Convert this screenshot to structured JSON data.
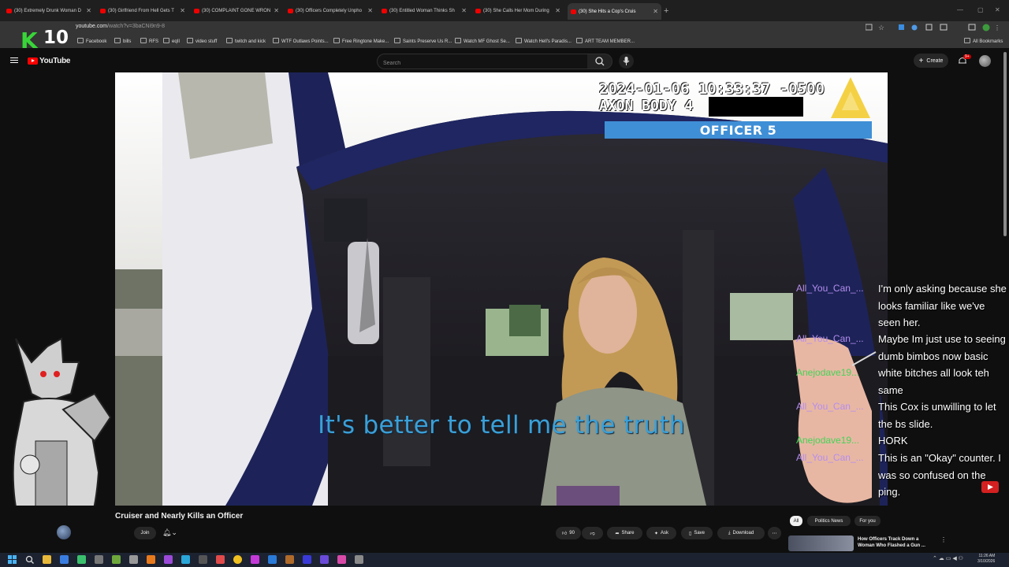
{
  "browser": {
    "tabs": [
      {
        "title": "(30) Extremely Drunk Woman D"
      },
      {
        "title": "(30) Girlfriend From Hell Gets T"
      },
      {
        "title": "(30) COMPLAINT GONE WRON"
      },
      {
        "title": "(30) Officers Completely Unpho"
      },
      {
        "title": "(30) Entitled Woman Thinks Sh"
      },
      {
        "title": "(30) She Calls Her Mom During"
      },
      {
        "title": "(30) She Hits a Cop's Cruis"
      }
    ],
    "url": "youtube.com",
    "url_path": "/watch?v=3baCNi9n9-8",
    "bookmarks": [
      "Facebook",
      "bills",
      "RFS",
      "eqII",
      "video stuff",
      "twitch and kick",
      "WTF Outlaws Points...",
      "Free Ringtone Make...",
      "Saints Preserve Us R...",
      "Watch MF Ghost Se...",
      "Watch Hell's Paradis...",
      "ART TEAM MEMBER..."
    ],
    "all_bookmarks": "All Bookmarks"
  },
  "stream_logo": {
    "k": "K",
    "num": "10"
  },
  "youtube": {
    "logo": "YouTube",
    "search_placeholder": "Search",
    "create": "Create",
    "notif_badge": "9+"
  },
  "video": {
    "timestamp": "2024-01-06 10:33:37 -0500",
    "camera": "AXON BODY 4",
    "officer_label": "OFFICER 5",
    "subtitle": "It's better to tell me the truth"
  },
  "chat": [
    {
      "user": "All_You_Can_...",
      "color": "purple",
      "message": "I'm only asking because she looks familiar like we've seen her."
    },
    {
      "user": "All_You_Can_...",
      "color": "purple",
      "message": "Maybe Im just use to seeing dumb bimbos now basic white bitches all look teh same"
    },
    {
      "user": "Anejodave19...",
      "color": "green",
      "message": ""
    },
    {
      "user": "All_You_Can_...",
      "color": "purple",
      "message": "This Cox is unwilling to let the bs slide."
    },
    {
      "user": "Anejodave19...",
      "color": "green",
      "message": "HORK"
    },
    {
      "user": "All_You_Can_...",
      "color": "purple",
      "message": "This is an \"Okay\" counter. I was so confused on the ping."
    }
  ],
  "below_video": {
    "title": "Cruiser and Nearly Kills an Officer",
    "join": "Join",
    "likes": "90",
    "share": "Share",
    "ask": "Ask",
    "save": "Save",
    "download": "Download"
  },
  "chips": [
    "All",
    "Politics News",
    "For you"
  ],
  "recommendation": {
    "title": "How Officers Track Down a Woman Who Flashed a Gun ..."
  },
  "clock": {
    "time": "11:26 AM",
    "date": "3/10/2026"
  }
}
